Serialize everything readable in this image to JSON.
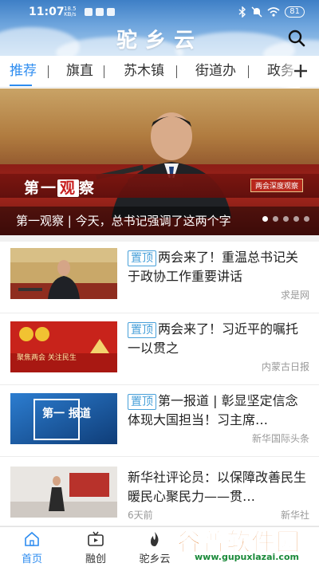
{
  "status_bar": {
    "time": "11:07",
    "net_speed": "18.5",
    "net_unit": "KB/s",
    "battery": "81"
  },
  "app": {
    "title": "驼乡云"
  },
  "tabs": [
    {
      "label": "推荐",
      "active": true
    },
    {
      "label": "旗直",
      "active": false
    },
    {
      "label": "苏木镇",
      "active": false
    },
    {
      "label": "街道办",
      "active": false
    },
    {
      "label": "政务",
      "active": false
    }
  ],
  "banner": {
    "plate_left": "第一",
    "plate_highlight": "观",
    "plate_right": "察",
    "badge": "两会深度观察",
    "caption": "第一观察 | 今天，总书记强调了这两个字",
    "slides_total": 5,
    "slide_active": 0
  },
  "news": [
    {
      "pin": "置顶",
      "title": "两会来了！重温总书记关于政协工作重要讲话",
      "source": "求是网",
      "thumb_text": ""
    },
    {
      "pin": "置顶",
      "title": "两会来了！习近平的嘱托一以贯之",
      "source": "内蒙古日报",
      "thumb_text": "聚焦两会 关注民生"
    },
    {
      "pin": "置顶",
      "title": "第一报道 | 彰显坚定信念 体现大国担当！习主席…",
      "source": "新华国际头条",
      "thumb_text": "第一 报道"
    },
    {
      "pin": "",
      "title": "新华社评论员：以保障改善民生暖民心聚民力——贯…",
      "source": "新华社",
      "age": "6天前",
      "thumb_text": ""
    }
  ],
  "bottom_nav": [
    {
      "label": "首页",
      "icon": "home-icon",
      "active": true
    },
    {
      "label": "融创",
      "icon": "video-icon",
      "active": false
    },
    {
      "label": "驼乡云",
      "icon": "flame-icon",
      "active": false
    }
  ],
  "watermark": {
    "text": "谷普软件园",
    "url": "www.gupuxlazai.com"
  },
  "colors": {
    "accent": "#2d8cf0",
    "pin_border": "#48a0d9",
    "header_top": "#3e7fc6",
    "watermark_orange": "#e0731c"
  }
}
